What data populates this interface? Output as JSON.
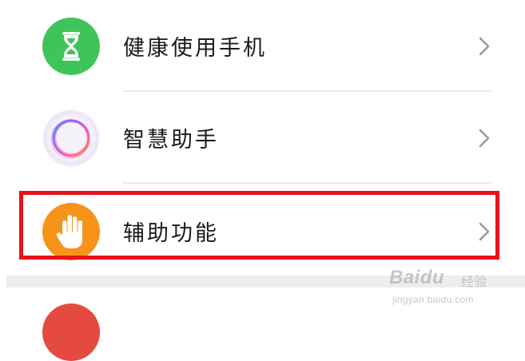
{
  "settings": {
    "items": [
      {
        "label": "健康使用手机",
        "icon": "hourglass-icon",
        "icon_color": "#3fc45a"
      },
      {
        "label": "智慧助手",
        "icon": "smart-assistant-ring-icon",
        "icon_color": "#f6f3f8"
      },
      {
        "label": "辅助功能",
        "icon": "hand-icon",
        "icon_color": "#f7931b",
        "highlighted": true
      }
    ],
    "chevron_icon": "chevron-right-icon",
    "highlight_color": "#e8121a"
  },
  "watermark": {
    "brand": "Baidu",
    "brand_suffix": "经验",
    "url": "jingyan.baidu.com"
  }
}
